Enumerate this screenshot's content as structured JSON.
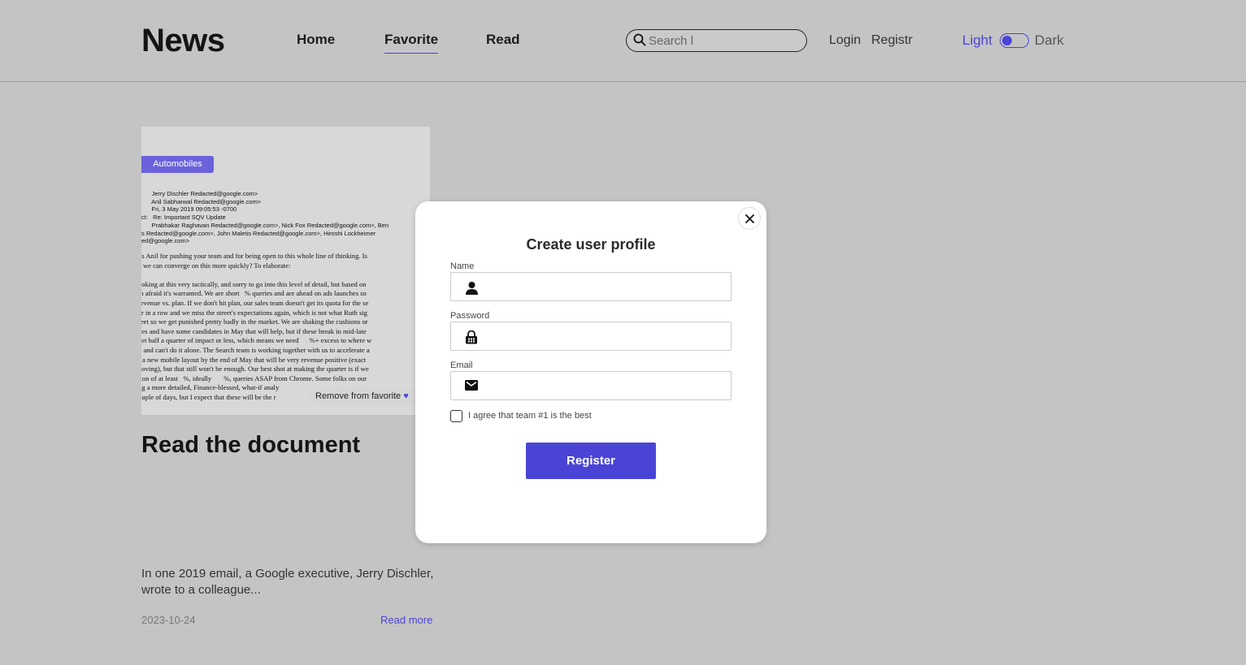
{
  "header": {
    "logo": "News",
    "nav": {
      "home": "Home",
      "favorite": "Favorite",
      "read": "Read"
    },
    "search_placeholder": "Search l",
    "login": "Login",
    "register": "Registr",
    "theme_light": "Light",
    "theme_dark": "Dark"
  },
  "card": {
    "category": "Automobiles",
    "doc_header": "      Jerry Dischler Redacted@google.com>\n      Anil Sabharwal Redacted@google.com>\n      Fri, 3 May 2019 09:05:53 -0700\nct:   Re: Important SQV Update\n      Prabhakar Raghavan Redacted@google.com>, Nick Fox Redacted@google.com>, Ben\ns Redacted@google.com>, John Maletis Redacted@google.com>, Hiroshi Lockheimer\ned@google.com>",
    "doc_body": "ks Anil for pushing your team and for being open to this whole line of thinking. Is\ne we can converge on this more quickly? To elaborate:\n\nooking at this very tactically, and sorry to go into this level of detail, but based on\nm afraid it's warranted. We are short   % queries and are ahead on ads launches so\nrevenue vs. plan. If we don't hit plan, our sales team doesn't get its quota for the se\ner in a row and we miss the street's expectations again, which is not what Ruth sig\nreet so we get punished pretty badly in the market. We are shaking the cushions or\nhes and have some candidates in May that will help, but if these break in mid-late\nget half a quarter of impact or less, which means we need      %+ excess to where w\ny and can't do it alone. The Search team is working together with us to accelerate a\nf a new mobile layout by the end of May that will be very revenue positive (exact\nnoving), but that still won't be enough. Our best shot at making the quarter is if we\ntion of at least   %, ideally       %, queries ASAP from Chrome. Some folks on our\nng a more detailed, Finance-blessed, what-if analy\nouple of days, but I expect that these will be the r",
    "remove_favorite": "Remove from favorite",
    "title": "Read the document",
    "description": "In one 2019 email, a Google executive, Jerry Dischler, wrote to a colleague...",
    "date": "2023-10-24",
    "read_more": "Read more"
  },
  "modal": {
    "title": "Create user profile",
    "name_label": "Name",
    "password_label": "Password",
    "email_label": "Email",
    "agree_label": "I agree that team #1 is the best",
    "register_button": "Register"
  },
  "icons": {
    "search": "search-icon",
    "user": "user-icon",
    "lock": "lock-icon",
    "mail": "mail-icon",
    "close": "close-icon",
    "heart": "heart-icon"
  },
  "colors": {
    "accent": "#4a44d6",
    "badge": "#6b62dc",
    "background": "#c4c4c4"
  }
}
